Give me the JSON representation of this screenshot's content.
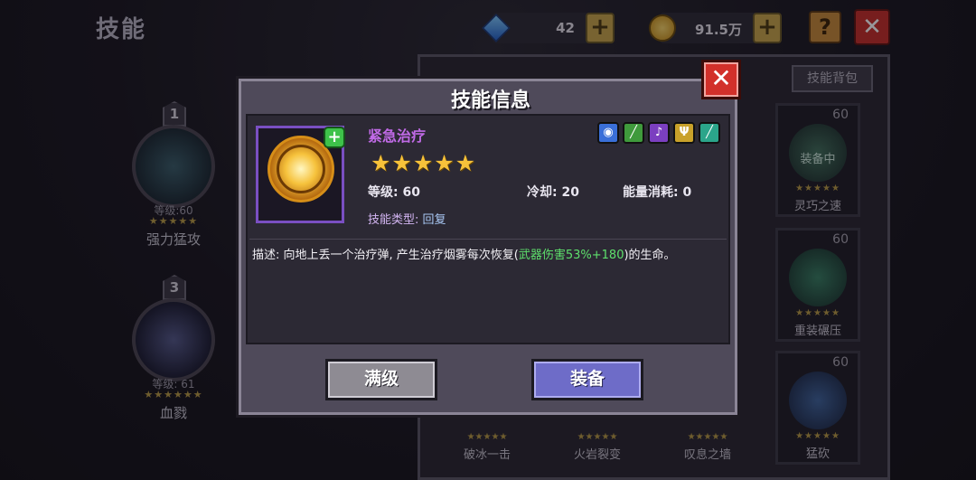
{
  "header": {
    "title": "技能",
    "gems": "42",
    "coins": "91.5万",
    "help": "?",
    "close": "✕"
  },
  "left_slots": [
    {
      "num": "1",
      "level": "等级:60",
      "stars": "★★★★★",
      "name": "强力猛攻"
    },
    {
      "num": "3",
      "level": "等级: 61",
      "stars": "★★★★★★",
      "name": "血戮"
    }
  ],
  "right_panel": {
    "bag_label": "技能背包",
    "cards": [
      {
        "lv": "60",
        "tag": "装备中",
        "stars": "★★★★★",
        "name": "灵巧之速"
      },
      {
        "lv": "60",
        "tag": "",
        "stars": "★★★★★",
        "name": "重装碾压"
      },
      {
        "lv": "60",
        "tag": "",
        "stars": "★★★★★",
        "name": "猛砍"
      }
    ],
    "bottom_names": [
      "破冰一击",
      "火岩裂变",
      "叹息之墙"
    ],
    "bottom_stars": "★★★★★"
  },
  "modal": {
    "title": "技能信息",
    "close": "✕",
    "skill_name": "紧急治疗",
    "stars": "★★★★★",
    "level_label": "等级: 60",
    "cooldown_label": "冷却: 20",
    "energy_label": "能量消耗: 0",
    "type_key": "技能类型: ",
    "type_value": "回复",
    "desc_pre": "描述: 向地上丢一个治疗弹, 产生治疗烟雾每次恢复(",
    "desc_hl": "武器伤害53%+180",
    "desc_post": ")的生命。",
    "btn_max": "满级",
    "btn_equip": "装备",
    "plus_badge": "+"
  },
  "weapon_icons": [
    {
      "name": "shield-icon",
      "color": "#3a6fd8",
      "glyph": "◉"
    },
    {
      "name": "bow-icon",
      "color": "#3f9a3c",
      "glyph": "╱"
    },
    {
      "name": "staff-icon",
      "color": "#7b3fc0",
      "glyph": "♪"
    },
    {
      "name": "trident-icon",
      "color": "#c9a12a",
      "glyph": "Ψ"
    },
    {
      "name": "sword-icon",
      "color": "#2ba58a",
      "glyph": "╱"
    }
  ]
}
